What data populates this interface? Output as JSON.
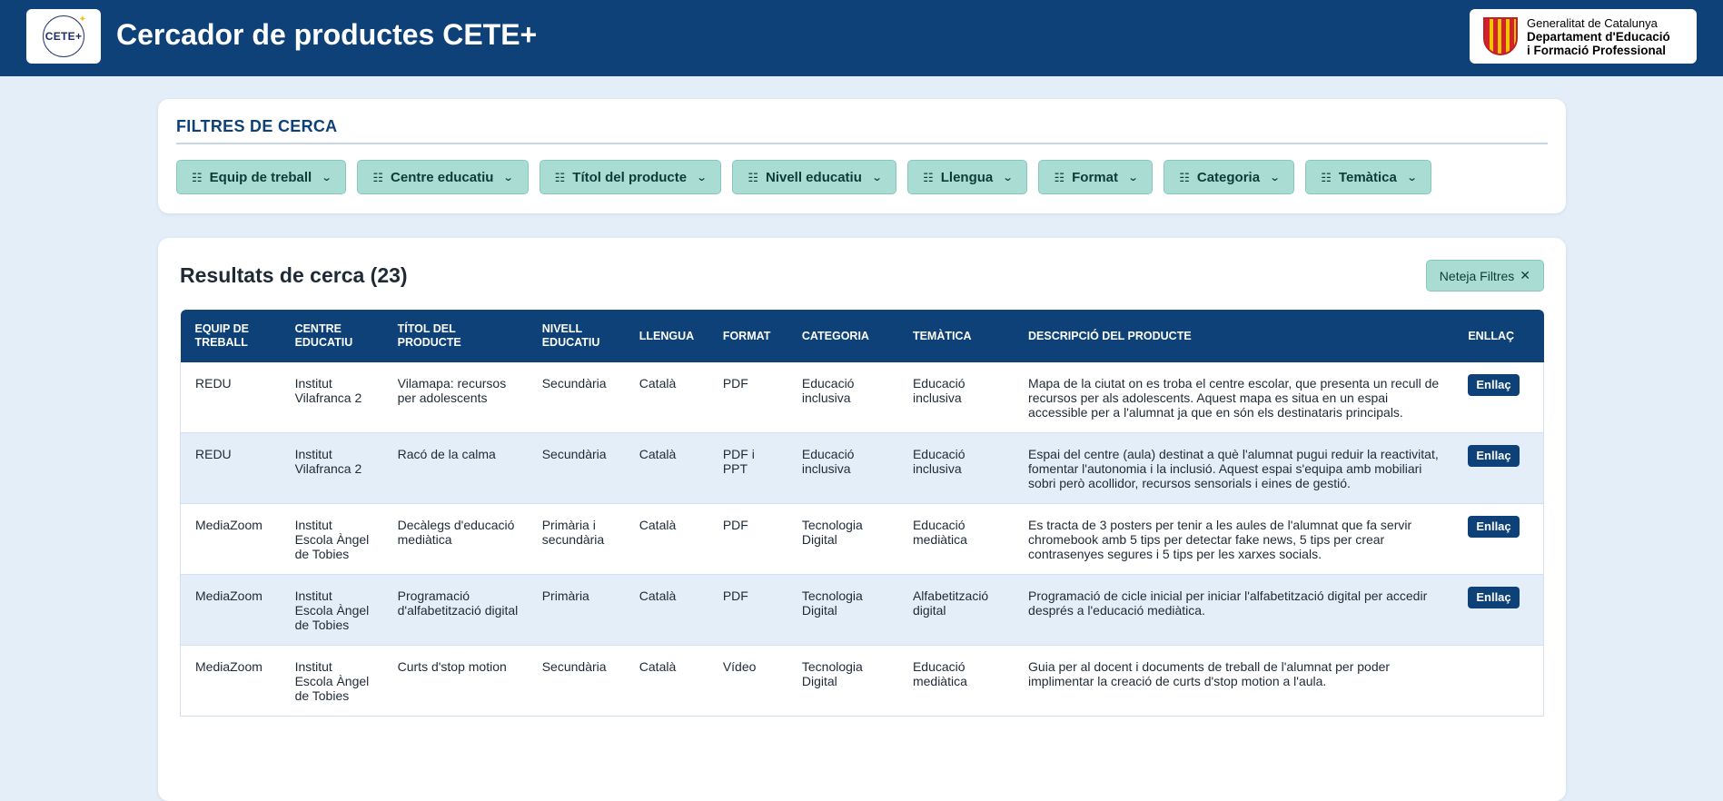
{
  "header": {
    "logo_text": "CETE+",
    "title": "Cercador de productes CETE+",
    "gov_line1": "Generalitat de Catalunya",
    "gov_line2": "Departament d'Educació",
    "gov_line3": "i Formació Professional",
    "brand_color": "#0d4177"
  },
  "filters": {
    "title": "FILTRES DE CERCA",
    "icon": "layers-icon",
    "items": [
      {
        "label": "Equip de treball"
      },
      {
        "label": "Centre educatiu"
      },
      {
        "label": "Títol del producte"
      },
      {
        "label": "Nivell educatiu"
      },
      {
        "label": "Llengua"
      },
      {
        "label": "Format"
      },
      {
        "label": "Categoria"
      },
      {
        "label": "Temàtica"
      }
    ]
  },
  "results": {
    "title": "Resultats de cerca (23)",
    "clear_label": "Neteja Filtres",
    "columns": [
      "EQUIP DE TREBALL",
      "CENTRE EDUCATIU",
      "TÍTOL DEL PRODUCTE",
      "NIVELL EDUCATIU",
      "LLENGUA",
      "FORMAT",
      "CATEGORIA",
      "TEMÀTICA",
      "DESCRIPCIÓ DEL PRODUCTE",
      "ENLLAÇ"
    ],
    "link_label": "Enllaç",
    "rows": [
      {
        "team": "REDU",
        "center": "Institut Vilafranca 2",
        "title": "Vilamapa: recursos per adolescents",
        "level": "Secundària",
        "lang": "Català",
        "format": "PDF",
        "category": "Educació inclusiva",
        "theme": "Educació inclusiva",
        "desc": "Mapa de la ciutat on es troba el centre escolar, que presenta un recull de recursos per als adolescents. Aquest mapa es situa en un espai accessible per a l'alumnat ja que en són els destinataris principals.",
        "link": "Enllaç"
      },
      {
        "team": "REDU",
        "center": "Institut Vilafranca 2",
        "title": "Racó de la calma",
        "level": "Secundària",
        "lang": "Català",
        "format": "PDF i PPT",
        "category": "Educació inclusiva",
        "theme": "Educació inclusiva",
        "desc": "Espai del centre (aula) destinat a què l'alumnat pugui reduir la reactivitat, fomentar l'autonomia i la inclusió. Aquest espai s'equipa amb mobiliari sobri però acollidor, recursos sensorials i eines de gestió.",
        "link": "Enllaç"
      },
      {
        "team": "MediaZoom",
        "center": "Institut Escola Àngel de Tobies",
        "title": "Decàlegs d'educació mediàtica",
        "level": "Primària i secundària",
        "lang": "Català",
        "format": "PDF",
        "category": "Tecnologia Digital",
        "theme": "Educació mediàtica",
        "desc": "Es tracta de 3 posters per tenir a les aules de l'alumnat que fa servir chromebook amb 5 tips per detectar fake news, 5 tips per crear contrasenyes segures i 5 tips per les xarxes socials.",
        "link": "Enllaç"
      },
      {
        "team": "MediaZoom",
        "center": "Institut Escola Àngel de Tobies",
        "title": "Programació d'alfabetització digital",
        "level": "Primària",
        "lang": "Català",
        "format": "PDF",
        "category": "Tecnologia Digital",
        "theme": "Alfabetització digital",
        "desc": "Programació de cicle inicial per iniciar l'alfabetització digital per accedir després a l'educació mediàtica.",
        "link": "Enllaç"
      },
      {
        "team": "MediaZoom",
        "center": "Institut Escola Àngel de Tobies",
        "title": "Curts d'stop motion",
        "level": "Secundària",
        "lang": "Català",
        "format": "Vídeo",
        "category": "Tecnologia Digital",
        "theme": "Educació mediàtica",
        "desc": "Guia per al docent i documents de treball de l'alumnat per poder implimentar la creació de curts d'stop motion a l'aula.",
        "link": ""
      }
    ]
  }
}
